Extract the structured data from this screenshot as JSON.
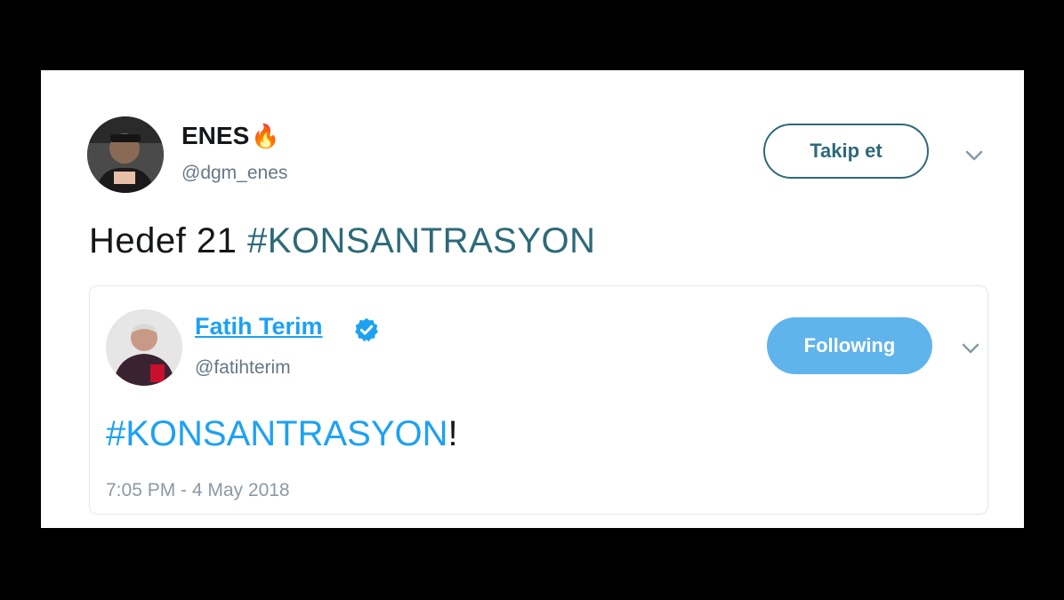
{
  "tweet": {
    "author": {
      "name": "ENES",
      "emoji": "🔥",
      "handle": "@dgm_enes"
    },
    "follow_button_label": "Takip et",
    "text_plain": "Hedef 21 ",
    "text_hashtag": "#KONSANTRASYON"
  },
  "quoted_tweet": {
    "author": {
      "name": "Fatih Terim",
      "handle": "@fatihterim",
      "verified": true
    },
    "follow_button_label": "Following",
    "text_hashtag": "#KONSANTRASYON",
    "text_suffix": "!",
    "timestamp": "7:05 PM - 4 May 2018"
  },
  "colors": {
    "accent": "#1da1f2",
    "dark_accent": "#2d6a78",
    "following_bg": "#5fb4ec",
    "muted": "#657786"
  },
  "icons": [
    "fire-emoji-icon",
    "verified-badge-icon",
    "chevron-down-icon"
  ]
}
